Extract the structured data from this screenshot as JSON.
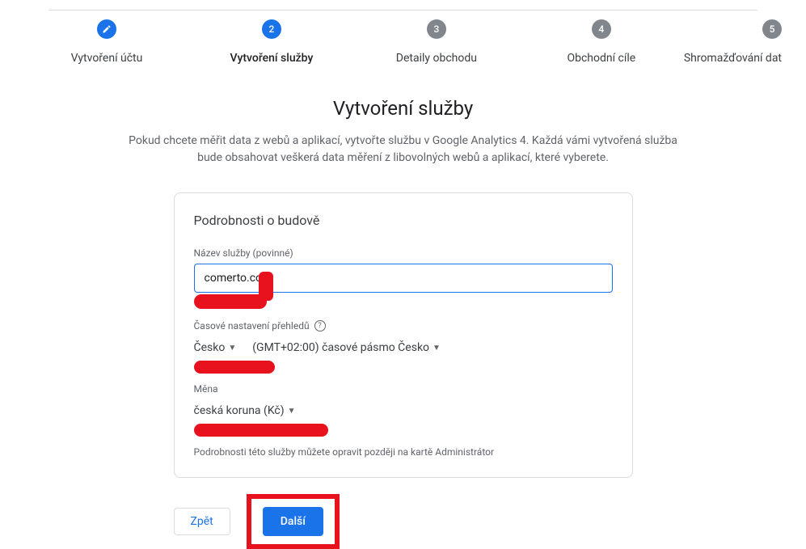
{
  "stepper": {
    "steps": [
      {
        "label": "Vytvoření účtu",
        "state": "done"
      },
      {
        "label": "Vytvoření služby",
        "state": "active",
        "num": "2"
      },
      {
        "label": "Detaily obchodu",
        "state": "pending",
        "num": "3"
      },
      {
        "label": "Obchodní cíle",
        "state": "pending",
        "num": "4"
      },
      {
        "label": "Shromažďování dat",
        "state": "pending",
        "num": "5"
      }
    ]
  },
  "page": {
    "title": "Vytvoření služby",
    "subtitle": "Pokud chcete měřit data z webů a aplikací, vytvořte službu v Google Analytics 4. Každá vámi vytvořená služba bude obsahovat veškerá data měření z libovolných webů a aplikací, které vyberete."
  },
  "card": {
    "title": "Podrobnosti o budově",
    "name_label": "Název služby (povinné)",
    "name_value": "comerto.com",
    "timezone_label": "Časové nastavení přehledů",
    "country": "Česko",
    "timezone": "(GMT+02:00) časové pásmo Česko",
    "currency_label": "Měna",
    "currency": "česká koruna (Kč)",
    "hint": "Podrobnosti této služby můžete opravit později na kartě Administrátor"
  },
  "buttons": {
    "back": "Zpět",
    "next": "Další"
  }
}
